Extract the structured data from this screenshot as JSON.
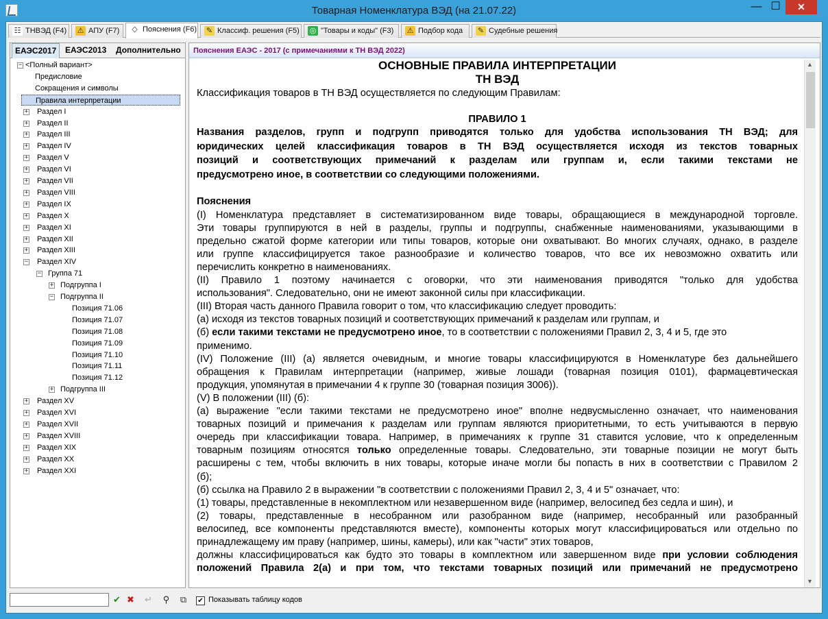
{
  "window": {
    "title": "Товарная Номенклатура ВЭД (на 21.07.22)",
    "minimize": "—",
    "maximize": "☐",
    "close": "✕"
  },
  "tabs": [
    {
      "label": "ТНВЭД (F4)",
      "icon": "tree-icon"
    },
    {
      "label": "АПУ (F7)",
      "icon": "warning-icon"
    },
    {
      "label": "Пояснения (F6)",
      "icon": "tag-icon"
    },
    {
      "label": "Классиф. решения (F5)",
      "icon": "comment-icon"
    },
    {
      "label": "\"Товары и коды\" (F3)",
      "icon": "goods-icon"
    },
    {
      "label": "Подбор кода",
      "icon": "warning-icon"
    },
    {
      "label": "Судебные решения",
      "icon": "comment-icon"
    }
  ],
  "left": {
    "subtabs": [
      "ЕАЭС2017",
      "ЕАЭС2013",
      "Дополнительно"
    ],
    "tree": [
      {
        "label": "<Полный вариант>",
        "level": 0,
        "exp": "−"
      },
      {
        "label": "Предисловие",
        "level": 1
      },
      {
        "label": "Сокращения и символы",
        "level": 1
      },
      {
        "label": "Правила интерпретации",
        "level": 1,
        "selected": true
      },
      {
        "label": "Раздел I",
        "level": 1,
        "exp": "+"
      },
      {
        "label": "Раздел II",
        "level": 1,
        "exp": "+"
      },
      {
        "label": "Раздел III",
        "level": 1,
        "exp": "+"
      },
      {
        "label": "Раздел IV",
        "level": 1,
        "exp": "+"
      },
      {
        "label": "Раздел V",
        "level": 1,
        "exp": "+"
      },
      {
        "label": "Раздел VI",
        "level": 1,
        "exp": "+"
      },
      {
        "label": "Раздел VII",
        "level": 1,
        "exp": "+"
      },
      {
        "label": "Раздел VIII",
        "level": 1,
        "exp": "+"
      },
      {
        "label": "Раздел IX",
        "level": 1,
        "exp": "+"
      },
      {
        "label": "Раздел X",
        "level": 1,
        "exp": "+"
      },
      {
        "label": "Раздел XI",
        "level": 1,
        "exp": "+"
      },
      {
        "label": "Раздел XII",
        "level": 1,
        "exp": "+"
      },
      {
        "label": "Раздел XIII",
        "level": 1,
        "exp": "+"
      },
      {
        "label": "Раздел XIV",
        "level": 1,
        "exp": "−"
      },
      {
        "label": "Группа 71",
        "level": 2,
        "exp": "−"
      },
      {
        "label": "Подгруппа I",
        "level": 3,
        "exp": "+"
      },
      {
        "label": "Подгруппа II",
        "level": 3,
        "exp": "−"
      },
      {
        "label": "Позиция 71.06",
        "level": 4
      },
      {
        "label": "Позиция 71.07",
        "level": 4
      },
      {
        "label": "Позиция 71.08",
        "level": 4
      },
      {
        "label": "Позиция 71.09",
        "level": 4
      },
      {
        "label": "Позиция 71.10",
        "level": 4
      },
      {
        "label": "Позиция 71.11",
        "level": 4
      },
      {
        "label": "Позиция 71.12",
        "level": 4
      },
      {
        "label": "Подгруппа III",
        "level": 3,
        "exp": "+"
      },
      {
        "label": "Раздел XV",
        "level": 1,
        "exp": "+"
      },
      {
        "label": "Раздел XVI",
        "level": 1,
        "exp": "+"
      },
      {
        "label": "Раздел XVII",
        "level": 1,
        "exp": "+"
      },
      {
        "label": "Раздел XVIII",
        "level": 1,
        "exp": "+"
      },
      {
        "label": "Раздел XIX",
        "level": 1,
        "exp": "+"
      },
      {
        "label": "Раздел XX",
        "level": 1,
        "exp": "+"
      },
      {
        "label": "Раздел XXI",
        "level": 1,
        "exp": "+"
      }
    ]
  },
  "right": {
    "header": "Пояснения ЕАЭС - 2017 (с примечаниями к ТН ВЭД 2022)",
    "doc": [
      {
        "cls": "ctr",
        "size": 17,
        "text": "ОСНОВНЫЕ ПРАВИЛА ИНТЕРПРЕТАЦИИ"
      },
      {
        "cls": "ctr",
        "size": 17,
        "text": "ТН ВЭД"
      },
      {
        "text": "Классификация товаров в ТН ВЭД осуществляется по следующим Правилам:"
      },
      {
        "text": ""
      },
      {
        "cls": "ctr",
        "text": "ПРАВИЛО 1"
      },
      {
        "cls": "b",
        "just": true,
        "text": "Названия разделов, групп и подгрупп приводятся только для удобства использования ТН ВЭД; для"
      },
      {
        "cls": "b",
        "just": true,
        "text": "юридических целей классификация товаров в ТН ВЭД осуществляется исходя из текстов товарных"
      },
      {
        "cls": "b",
        "just": true,
        "text": "позиций и соответствующих примечаний к разделам или группам и, если такими текстами не"
      },
      {
        "cls": "b",
        "text": "предусмотрено иное, в соответствии со следующими положениями."
      },
      {
        "text": ""
      },
      {
        "cls": "b",
        "text": "Пояснения"
      },
      {
        "just": true,
        "text": "(I)          Номенклатура представляет в систематизированном виде товары, обращающиеся в международной торговле."
      },
      {
        "just": true,
        "text": "Эти товары группируются в ней в разделы, группы и подгруппы, снабженные наименованиями, указывающими в"
      },
      {
        "just": true,
        "text": "предельно сжатой форме категории или типы товаров, которые они охватывают. Во многих случаях, однако, в разделе"
      },
      {
        "just": true,
        "text": "или группе классифицируется такое разнообразие и количество товаров, что все их невозможно охватить или"
      },
      {
        "text": "перечислить конкретно в наименованиях."
      },
      {
        "just": true,
        "text": "(II)                 Правило 1 поэтому начинается с оговорки, что эти наименования приводятся \"только для удобства"
      },
      {
        "text": "использования\". Следовательно, они не имеют законной силы при классификации."
      },
      {
        "text": "(III)         Вторая часть данного Правила говорит о том, что классификацию следует проводить:"
      },
      {
        "text": "(a)          исходя из текстов товарных позиций и соответствующих примечаний к разделам или группам, и"
      },
      {
        "html": "(б)           <b>если такими текстами не предусмотрено иное</b>, то в соответствии с положениями Правил 2, 3, 4 и 5, где это"
      },
      {
        "text": "применимо."
      },
      {
        "just": true,
        "text": "(IV)         Положение (III) (а) является очевидным, и многие товары классифицируются в Номенклатуре без дальнейшего"
      },
      {
        "just": true,
        "text": "обращения к Правилам интерпретации (например, живые лошади (товарная позиция 0101), фармацевтическая"
      },
      {
        "text": "продукция, упомянутая в примечании 4 к группе 30 (товарная позиция 3006))."
      },
      {
        "text": "(V)         В положении (III) (б):"
      },
      {
        "just": true,
        "text": "(a)          выражение \"если такими текстами не предусмотрено иное\" вполне недвусмысленно означает, что наименования"
      },
      {
        "just": true,
        "text": "товарных позиций и примечания к разделам или группам являются приоритетными, то есть учитываются в первую"
      },
      {
        "just": true,
        "text": "очередь при классификации товара. Например, в примечаниях к группе 31 ставится условие, что к определенным"
      },
      {
        "html": "товарным позициям относятся <b>только</b> определенные товары. Следовательно, эти товарные позиции не могут быть",
        "just": true
      },
      {
        "just": true,
        "text": "расширены с тем, чтобы включить в них товары, которые иначе могли бы попасть в них в соответствии с Правилом 2"
      },
      {
        "text": "(б);"
      },
      {
        "text": "(б)         ссылка на Правило 2 в выражении \"в соответствии с положениями Правил 2, 3, 4 и 5\" означает, что:"
      },
      {
        "text": "(1)         товары, представленные в некомплектном или незавершенном виде (например, велосипед без седла и шин), и"
      },
      {
        "just": true,
        "text": "(2)          товары, представленные в несобранном или разобранном виде (например, несобранный или разобранный"
      },
      {
        "just": true,
        "text": "велосипед, все компоненты представляются вместе), компоненты которых могут классифицироваться или отдельно по"
      },
      {
        "text": "принадлежащему им праву (например, шины, камеры), или как \"части\" этих товаров,"
      },
      {
        "html": "должны классифицироваться как будто это товары в комплектном или завершенном виде <b>при условии соблюдения</b>",
        "just": true
      },
      {
        "html": "<b>положений Правила 2(а) и при том, что текстами товарных позиций или примечаний не предусмотрено</b>",
        "just": true
      }
    ]
  },
  "bottom": {
    "checkbox_label": "Показывать таблицу кодов",
    "checked": "✔",
    "confirm": "✔",
    "cancel": "✖",
    "back": "↵",
    "find": "⚲",
    "copy": "⧉"
  }
}
